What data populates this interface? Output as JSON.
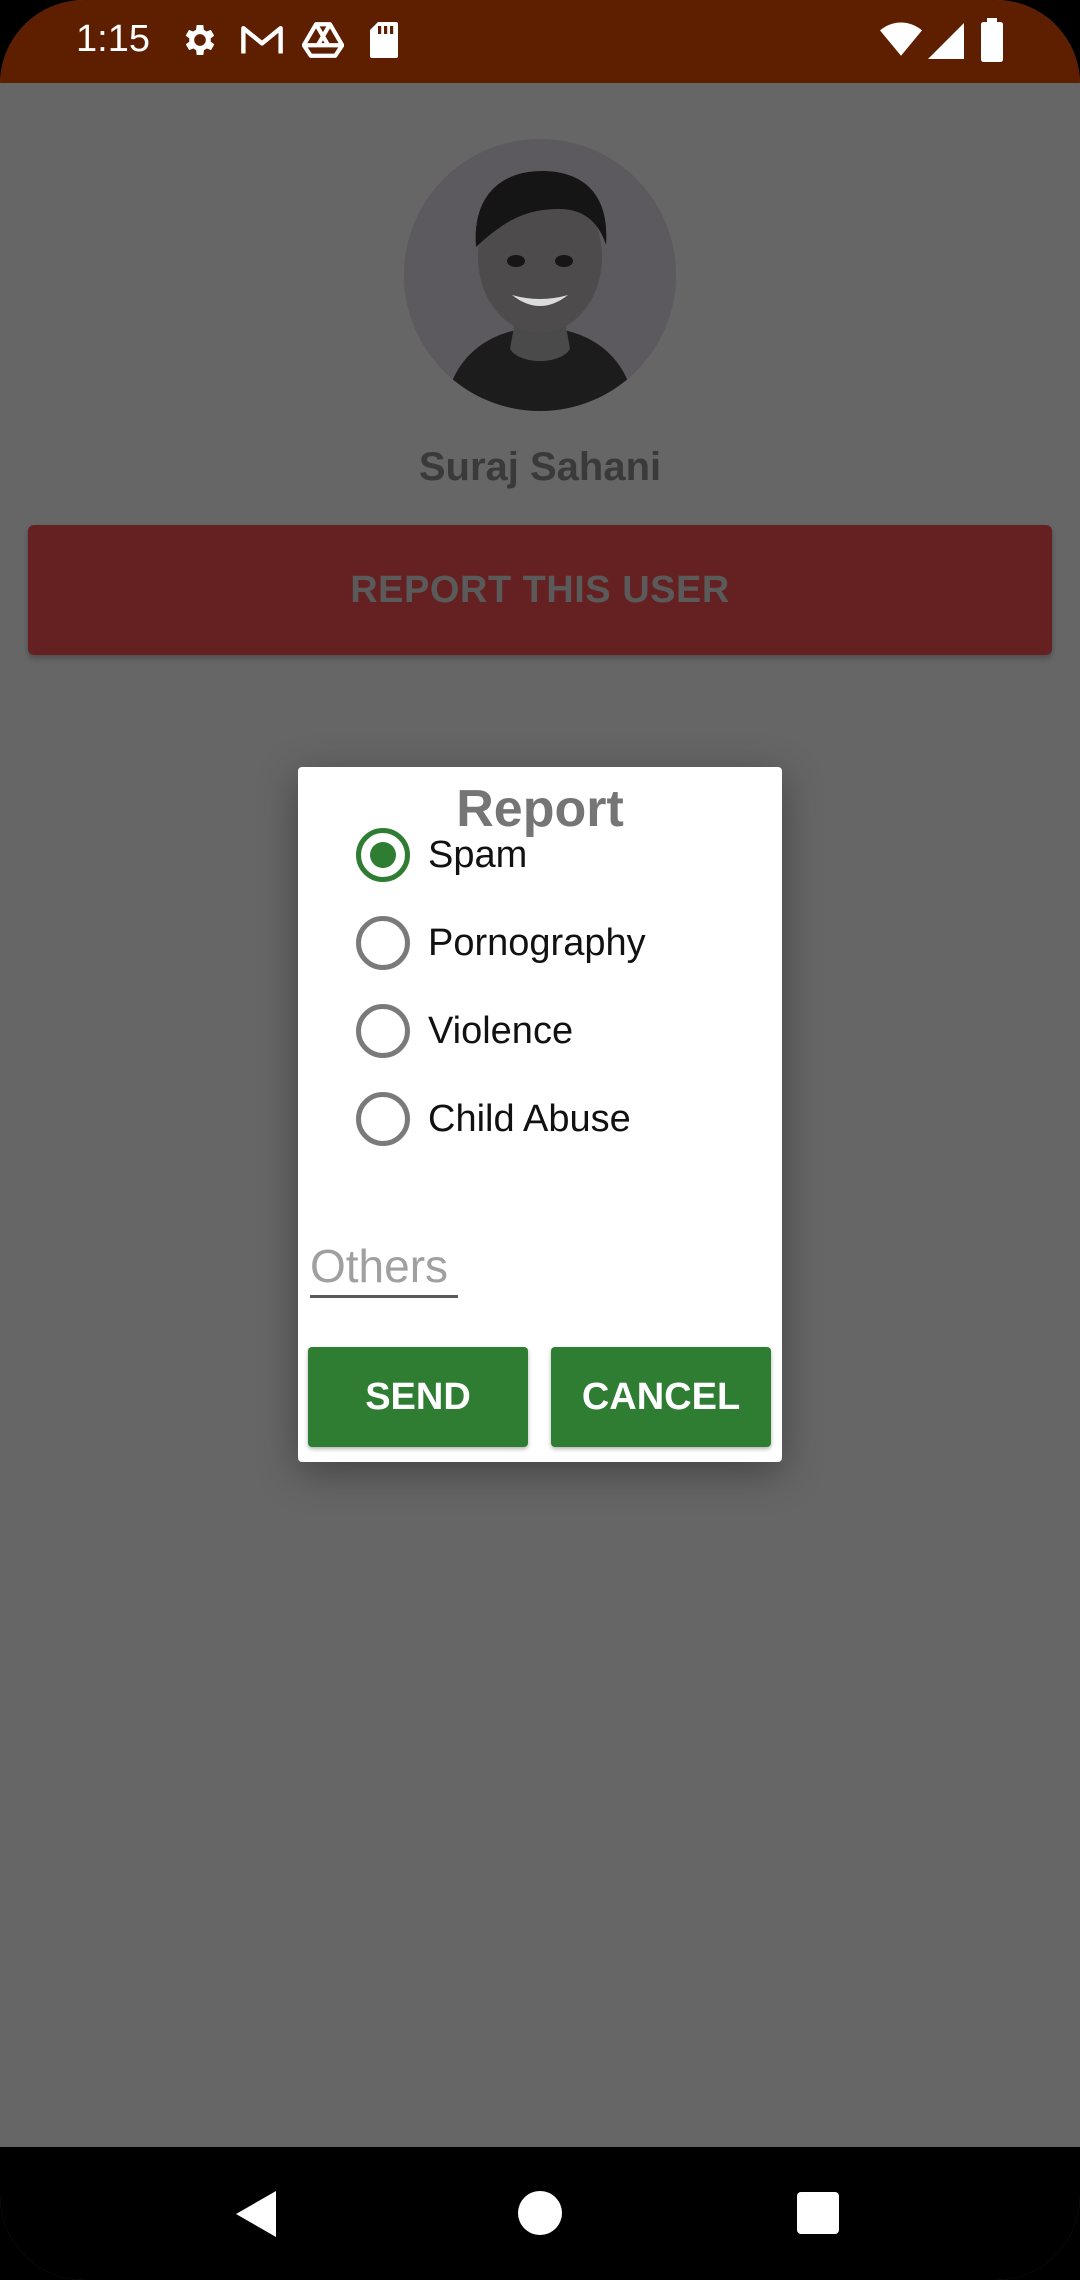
{
  "status_bar": {
    "time": "1:15",
    "left_icons": [
      "gear-icon",
      "gmail-icon",
      "drive-icon",
      "sd-card-icon"
    ],
    "right_icons": [
      "wifi-icon",
      "cell-signal-icon",
      "battery-icon"
    ]
  },
  "profile": {
    "name": "Suraj Sahani",
    "report_button_label": "REPORT THIS USER"
  },
  "dialog": {
    "title": "Report",
    "options": [
      {
        "label": "Spam",
        "checked": true
      },
      {
        "label": "Pornography",
        "checked": false
      },
      {
        "label": "Violence",
        "checked": false
      },
      {
        "label": "Child Abuse",
        "checked": false
      }
    ],
    "others_placeholder": "Others",
    "send_label": "SEND",
    "cancel_label": "CANCEL"
  },
  "nav_bar": {
    "icons": [
      "back-icon",
      "home-icon",
      "recents-icon"
    ]
  },
  "colors": {
    "status_bar": "#5e1f00",
    "scrim": "#666666",
    "report_button": "#652022",
    "accent_green": "#2e7d32"
  }
}
